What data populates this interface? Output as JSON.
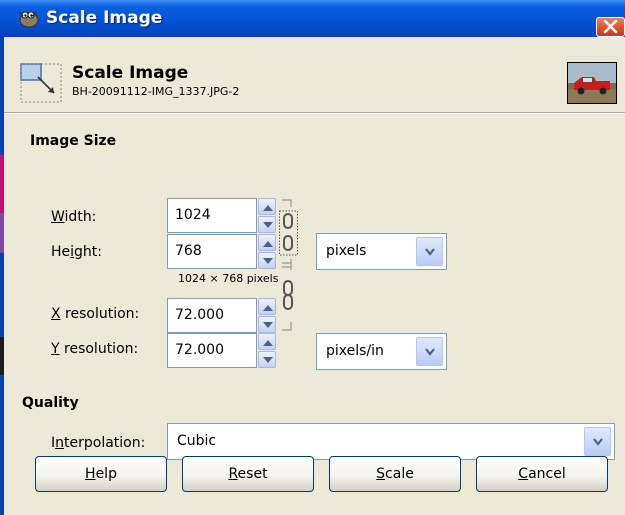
{
  "window": {
    "title": "Scale Image",
    "title_icon": "gimp-wilber-icon",
    "close_icon": "close-icon"
  },
  "header": {
    "title": "Scale Image",
    "subtitle": "BH-20091112-IMG_1337.JPG-2",
    "icon": "scale-tool-icon",
    "thumbnail": "image-thumbnail-red-truck"
  },
  "image_size": {
    "heading": "Image Size",
    "width": {
      "label_pre": "",
      "label_acc": "W",
      "label_post": "idth:",
      "value": "1024"
    },
    "height": {
      "label_pre": "He",
      "label_acc": "i",
      "label_post": "ght:",
      "value": "768"
    },
    "size_unit": "pixels",
    "dimensions_text": "1024 × 768 pixels",
    "x_resolution": {
      "label_pre": "",
      "label_acc": "X",
      "label_post": " resolution:",
      "value": "72.000"
    },
    "y_resolution": {
      "label_pre": "",
      "label_acc": "Y",
      "label_post": " resolution:",
      "value": "72.000"
    },
    "resolution_unit": "pixels/in",
    "chain_icon": "chain-link-icon"
  },
  "quality": {
    "heading": "Quality",
    "interpolation": {
      "label_pre": "I",
      "label_acc": "n",
      "label_post": "terpolation:",
      "value": "Cubic"
    }
  },
  "buttons": {
    "help": {
      "acc": "H",
      "rest": "elp"
    },
    "reset": {
      "acc": "R",
      "rest": "eset"
    },
    "scale": {
      "acc": "S",
      "rest": "cale"
    },
    "cancel": {
      "acc": "C",
      "rest": "ancel"
    }
  },
  "colors": {
    "titlebar": "#0453d6",
    "dialog_bg": "#ece9d8",
    "close_button": "#d8522c",
    "field_border": "#7f9db9"
  }
}
